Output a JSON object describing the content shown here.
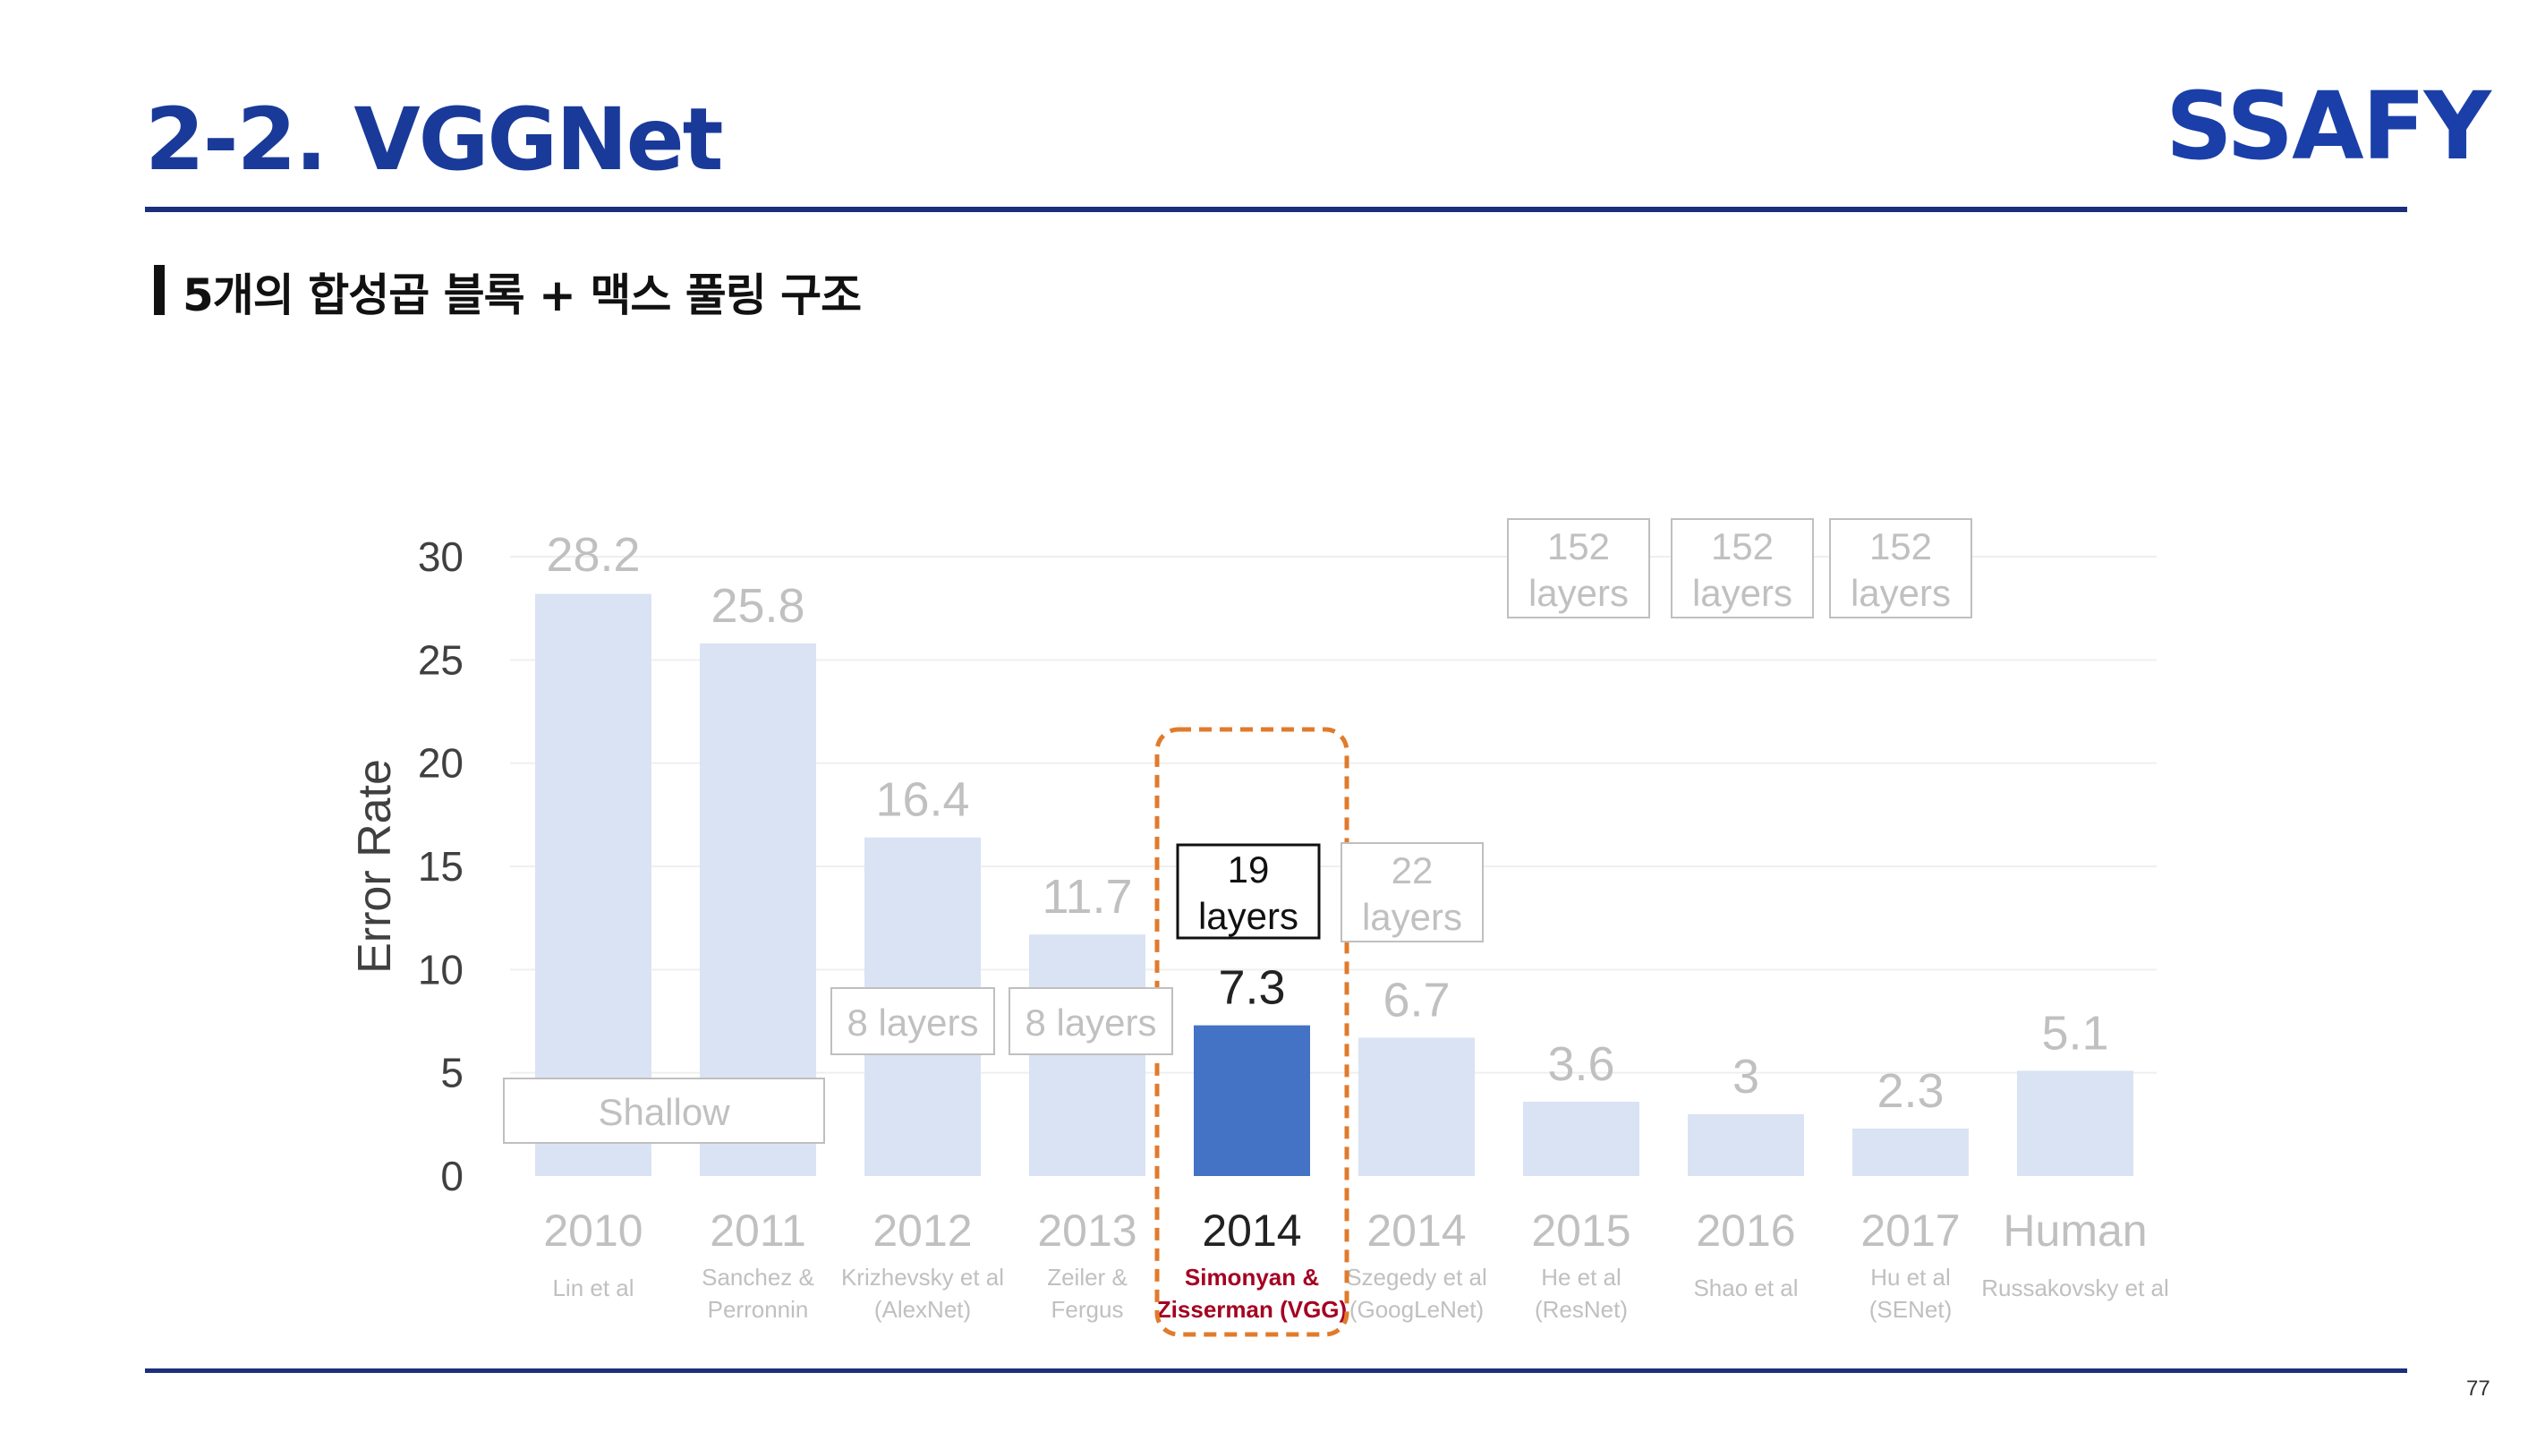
{
  "slide": {
    "title": "2-2. VGGNet",
    "subtitle": "5개의 합성곱 블록 + 맥스 풀링 구조",
    "logo_text": "SSAFY",
    "page_number": "77"
  },
  "colors": {
    "title": "#1a3a9a",
    "rule": "#1b2f7a",
    "bar_light": "#dae3f3",
    "bar_highlight": "#4472c4",
    "highlight_dash": "#e07b2c",
    "highlight_author": "#a50021",
    "faded_text": "#c0c0c0",
    "axis_text": "#404040"
  },
  "chart_data": {
    "type": "bar",
    "ylabel": "Error Rate",
    "ylim": [
      0,
      30
    ],
    "yticks": [
      0,
      5,
      10,
      15,
      20,
      25,
      30
    ],
    "grid": true,
    "highlight_index": 4,
    "categories": [
      "2010",
      "2011",
      "2012",
      "2013",
      "2014",
      "2014",
      "2015",
      "2016",
      "2017",
      "Human"
    ],
    "authors": [
      [
        "Lin et al"
      ],
      [
        "Sanchez &",
        "Perronnin"
      ],
      [
        "Krizhevsky et al",
        "(AlexNet)"
      ],
      [
        "Zeiler &",
        "Fergus"
      ],
      [
        "Simonyan &",
        "Zisserman (VGG)"
      ],
      [
        "Szegedy et al",
        "(GoogLeNet)"
      ],
      [
        "He et al",
        "(ResNet)"
      ],
      [
        "Shao et al"
      ],
      [
        "Hu et al",
        "(SENet)"
      ],
      [
        "Russakovsky et al"
      ]
    ],
    "values": [
      28.2,
      25.8,
      16.4,
      11.7,
      7.3,
      6.7,
      3.6,
      3,
      2.3,
      5.1
    ],
    "value_labels": [
      "28.2",
      "25.8",
      "16.4",
      "11.7",
      "7.3",
      "6.7",
      "3.6",
      "3",
      "2.3",
      "5.1"
    ],
    "layer_boxes": [
      {
        "bar_index": 0,
        "text": [
          "Shallow"
        ]
      },
      {
        "bar_index": 2,
        "text": [
          "8 layers"
        ]
      },
      {
        "bar_index": 3,
        "text": [
          "8 layers"
        ]
      },
      {
        "bar_index": 4,
        "text": [
          "19",
          "layers"
        ]
      },
      {
        "bar_index": 5,
        "text": [
          "22",
          "layers"
        ]
      },
      {
        "bar_index": 6,
        "text": [
          "152",
          "layers"
        ]
      },
      {
        "bar_index": 7,
        "text": [
          "152",
          "layers"
        ]
      },
      {
        "bar_index": 8,
        "text": [
          "152",
          "layers"
        ]
      }
    ]
  }
}
